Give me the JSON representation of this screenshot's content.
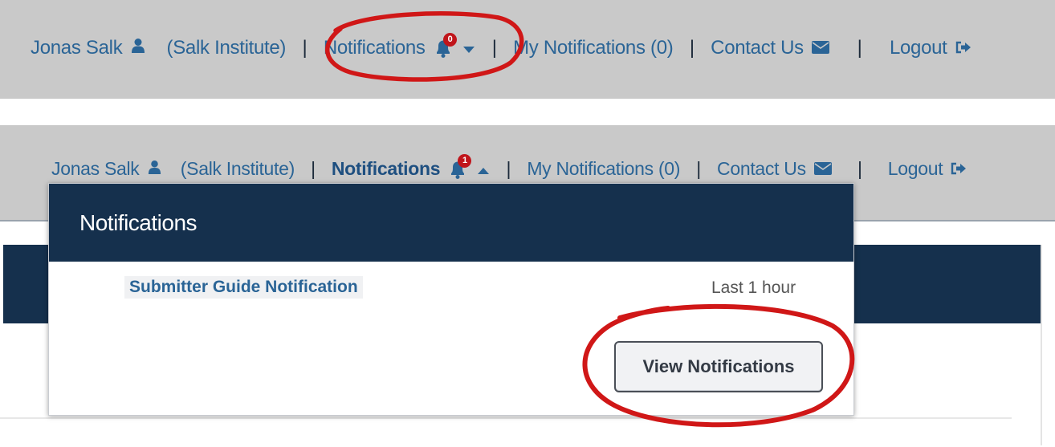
{
  "nav_top": {
    "user_name": "Jonas Salk",
    "institution": "(Salk Institute)",
    "notifications_label": "Notifications",
    "badge_count": "0",
    "my_notifications_label": "My Notifications (0)",
    "contact_label": "Contact Us",
    "logout_label": "Logout"
  },
  "nav_open": {
    "user_name": "Jonas Salk",
    "institution": "(Salk Institute)",
    "notifications_label": "Notifications",
    "badge_count": "1",
    "my_notifications_label": "My Notifications (0)",
    "contact_label": "Contact Us",
    "logout_label": "Logout"
  },
  "dropdown": {
    "title": "Notifications",
    "items": [
      {
        "title": "Submitter Guide Notification",
        "time": "Last 1 hour"
      }
    ],
    "view_button_label": "View Notifications"
  },
  "colors": {
    "nav_bg": "#c9c9c9",
    "link": "#2a6496",
    "header_navy": "#15304d",
    "badge_red": "#c0151b",
    "annotation_red": "#d01717"
  },
  "icons": [
    "user-icon",
    "bell-icon",
    "caret-down-icon",
    "caret-up-icon",
    "envelope-icon",
    "logout-icon"
  ]
}
